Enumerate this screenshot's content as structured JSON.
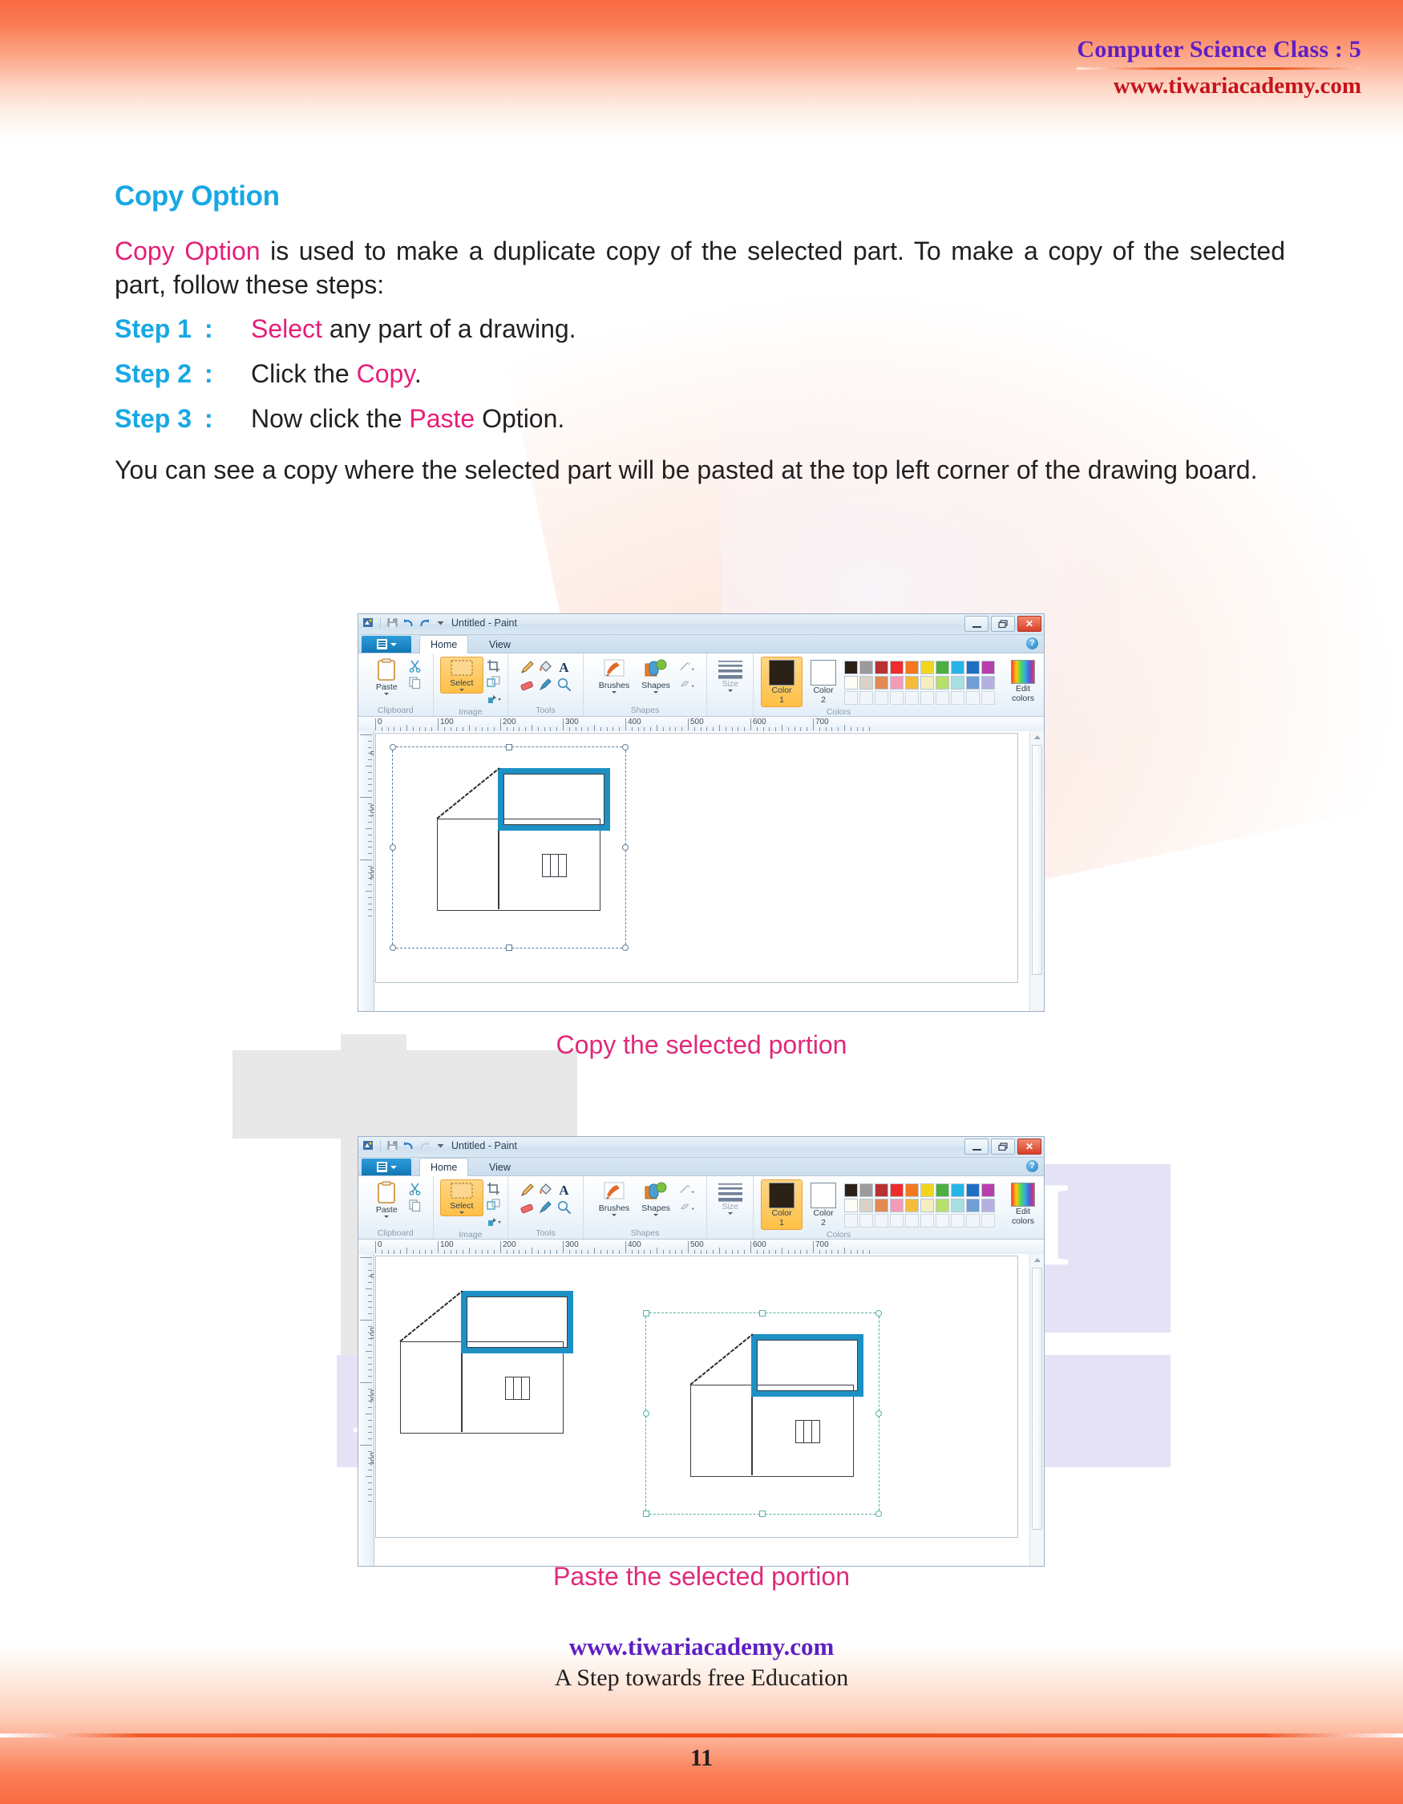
{
  "header": {
    "title": "Computer Science Class : 5",
    "url": "www.tiwariacademy.com"
  },
  "content": {
    "section_title": "Copy Option",
    "intro_lead": "Copy Option",
    "intro_rest": " is used to make a duplicate copy of the selected part. To make a copy of the selected part, follow these steps:",
    "steps": [
      {
        "label": "Step 1",
        "colon": ":",
        "pre": "",
        "highlight": "Select",
        "post": " any part of a drawing."
      },
      {
        "label": "Step 2",
        "colon": ":",
        "pre": "Click the ",
        "highlight": "Copy",
        "post": "."
      },
      {
        "label": "Step 3",
        "colon": ":",
        "pre": "Now click the ",
        "highlight": "Paste",
        "post": " Option."
      }
    ],
    "outro": "You can see a copy where the selected part will be pasted at the top left corner of the drawing board."
  },
  "figures": {
    "copy_caption": "Copy the selected portion",
    "paste_caption": "Paste the selected portion"
  },
  "paint": {
    "window_title": "Untitled - Paint",
    "tabs": [
      {
        "label": "Home",
        "active": true
      },
      {
        "label": "View",
        "active": false
      }
    ],
    "window_buttons": {
      "minimize": "minimize-icon",
      "restore": "restore-icon",
      "close": "close-icon",
      "help": "help-icon"
    },
    "quick_access": [
      "paint-app-icon",
      "save-icon",
      "undo-icon",
      "redo-icon",
      "customize-dropdown-icon"
    ],
    "groups": [
      {
        "label": "Clipboard",
        "items": [
          {
            "name": "Paste",
            "icon": "clipboard-icon",
            "caret": true
          },
          {
            "name": "Cut",
            "icon": "scissors-icon",
            "caret": false
          },
          {
            "name": "Copy",
            "icon": "copy-pages-icon",
            "caret": false
          }
        ]
      },
      {
        "label": "Image",
        "items": [
          {
            "name": "Select",
            "icon": "select-rect-icon",
            "caret": true,
            "highlighted": true
          },
          {
            "name": "Crop",
            "icon": "crop-icon",
            "caret": false
          },
          {
            "name": "Resize",
            "icon": "resize-icon",
            "caret": false
          },
          {
            "name": "Rotate",
            "icon": "rotate-icon",
            "caret": true
          }
        ]
      },
      {
        "label": "Tools",
        "items": [
          {
            "name": "Pencil",
            "icon": "pencil-icon"
          },
          {
            "name": "Fill with color",
            "icon": "paint-bucket-icon"
          },
          {
            "name": "Text",
            "icon": "text-a-icon"
          },
          {
            "name": "Eraser",
            "icon": "eraser-icon"
          },
          {
            "name": "Color picker",
            "icon": "eyedropper-icon"
          },
          {
            "name": "Magnifier",
            "icon": "magnifier-icon"
          }
        ]
      },
      {
        "label": "Shapes",
        "items": [
          {
            "name": "Brushes",
            "icon": "brush-icon",
            "caret": true
          },
          {
            "name": "Shapes",
            "icon": "shapes-icon",
            "caret": true
          },
          {
            "name": "Outline",
            "icon": "outline-icon",
            "caret": true
          },
          {
            "name": "Fill",
            "icon": "fill-icon",
            "caret": true
          }
        ]
      },
      {
        "label": "",
        "items": [
          {
            "name": "Size",
            "icon": "size-lines-icon",
            "caret": true
          }
        ]
      },
      {
        "label": "Colors",
        "items": [
          {
            "name": "Color 1",
            "icon": "color1-swatch",
            "caret": false
          },
          {
            "name": "Color 2",
            "icon": "color2-swatch",
            "caret": false
          },
          {
            "name": "Edit colors",
            "icon": "edit-colors-icon",
            "caret": false
          }
        ]
      }
    ],
    "size_label": "Size",
    "color1_label_line1": "Color",
    "color1_label_line2": "1",
    "color2_label_line1": "Color",
    "color2_label_line2": "2",
    "edit_colors_line1": "Edit",
    "edit_colors_line2": "colors",
    "color1_value": "#2b2117",
    "color2_value": "#ffffff",
    "palette_row1": [
      "#2b2117",
      "#9b9b9b",
      "#b83232",
      "#ef2b2b",
      "#f47820",
      "#f4d51e",
      "#4caf3f",
      "#28b4e6",
      "#1f6fc4",
      "#b73fab"
    ],
    "palette_row2": [
      "#fdfdf6",
      "#d9d2c7",
      "#e18a52",
      "#f59bb8",
      "#f5bb3a",
      "#f5eec0",
      "#b6e06a",
      "#a8dfe0",
      "#6f9ed6",
      "#b6b0e0"
    ],
    "ruler_h_labels": [
      "0",
      "100",
      "200",
      "300",
      "400",
      "500",
      "600",
      "700"
    ],
    "ruler_v_labels": [
      "0",
      "100",
      "200"
    ]
  },
  "paint2": {
    "ruler_v_labels": [
      "0",
      "100",
      "200",
      "300"
    ]
  },
  "watermark": {
    "line1": "TIWARI",
    "line2": "ACADEMY"
  },
  "footer": {
    "url": "www.tiwariacademy.com",
    "tagline": "A Step towards free Education",
    "page_number": "11"
  },
  "colors": {
    "accent_blue": "#17a8e3",
    "accent_pink": "#e61e78",
    "caption_pink": "#e0297a",
    "header_purple": "#5f1ec4",
    "header_red": "#c4141c",
    "band_orange": "#f96a42"
  }
}
